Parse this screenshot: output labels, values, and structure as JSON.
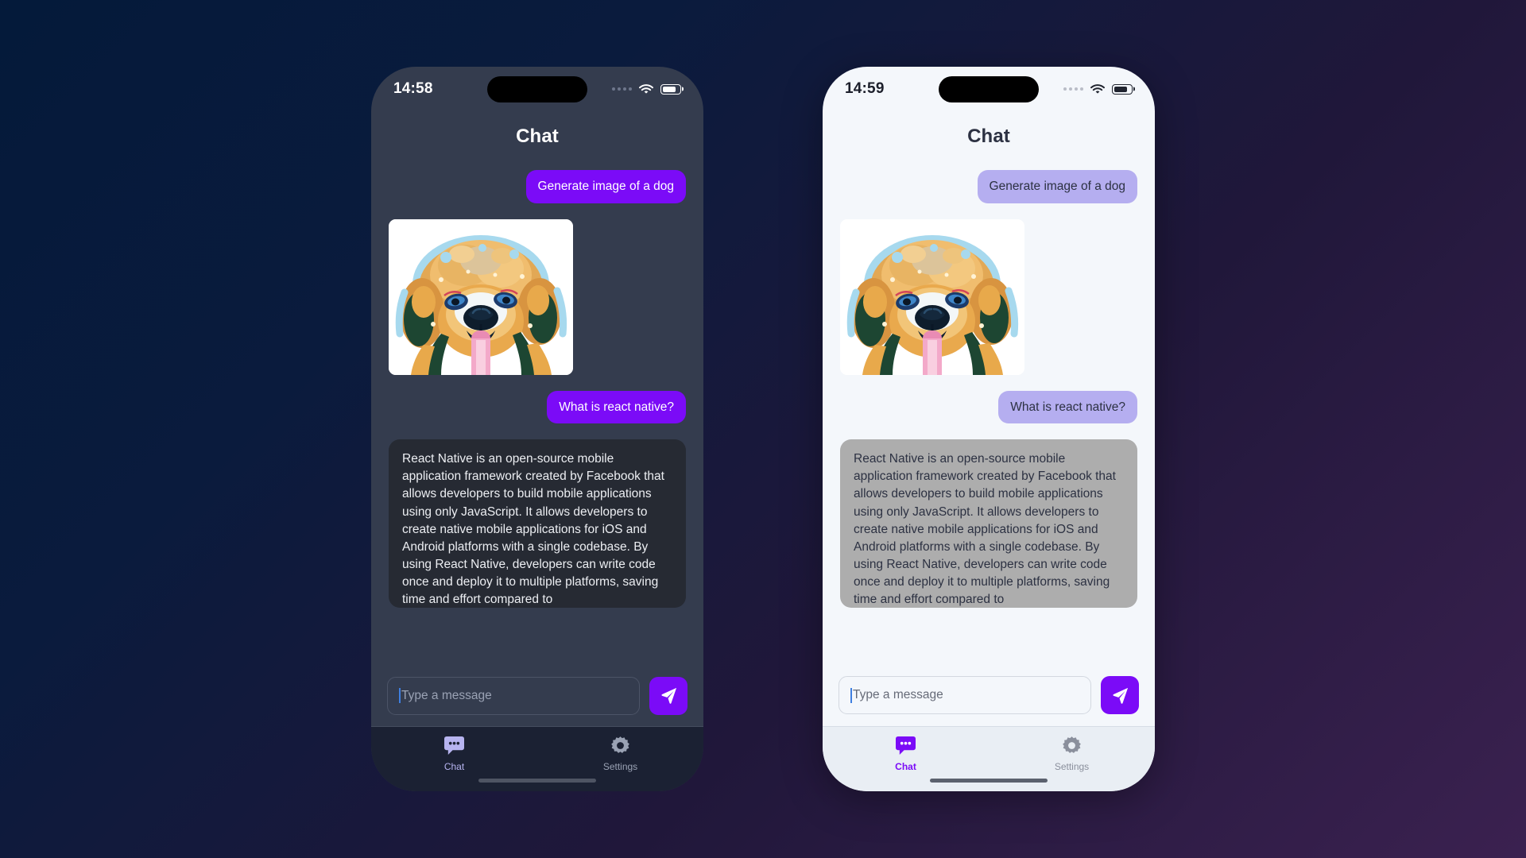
{
  "background": {
    "gradient_from": "#041a3a",
    "gradient_to": "#3b2150"
  },
  "accent": {
    "purple": "#7b0bf7",
    "lavender": "#b5aef0",
    "caret_blue": "#3f7fe0"
  },
  "phones": [
    {
      "theme": "dark",
      "status": {
        "time": "14:58",
        "signal_icon": "signal-dots-icon",
        "wifi_icon": "wifi-icon",
        "battery_icon": "battery-icon"
      },
      "header": {
        "title": "Chat"
      },
      "messages": [
        {
          "type": "text",
          "sender": "user",
          "text": "Generate image of a dog"
        },
        {
          "type": "image",
          "sender": "assistant",
          "alt": "generated-dog-image"
        },
        {
          "type": "text",
          "sender": "user",
          "text": "What is react native?"
        },
        {
          "type": "text",
          "sender": "assistant",
          "text": "React Native is an open-source mobile application framework created by Facebook that allows developers to build mobile applications using only JavaScript. It allows developers to create native mobile applications for iOS and Android platforms with a single codebase. By using React Native, developers can write code once and deploy it to multiple platforms, saving time and effort compared to"
        }
      ],
      "input": {
        "placeholder": "Type a message",
        "value": "",
        "send_icon": "send-paper-plane-icon"
      },
      "tabs": [
        {
          "label": "Chat",
          "icon": "chat-bubble-icon",
          "active": true
        },
        {
          "label": "Settings",
          "icon": "gear-icon",
          "active": false
        }
      ]
    },
    {
      "theme": "light",
      "status": {
        "time": "14:59",
        "signal_icon": "signal-dots-icon",
        "wifi_icon": "wifi-icon",
        "battery_icon": "battery-icon"
      },
      "header": {
        "title": "Chat"
      },
      "messages": [
        {
          "type": "text",
          "sender": "user",
          "text": "Generate image of a dog"
        },
        {
          "type": "image",
          "sender": "assistant",
          "alt": "generated-dog-image"
        },
        {
          "type": "text",
          "sender": "user",
          "text": "What is react native?"
        },
        {
          "type": "text",
          "sender": "assistant",
          "text": "React Native is an open-source mobile application framework created by Facebook that allows developers to build mobile applications using only JavaScript. It allows developers to create native mobile applications for iOS and Android platforms with a single codebase. By using React Native, developers can write code once and deploy it to multiple platforms, saving time and effort compared to"
        }
      ],
      "input": {
        "placeholder": "Type a message",
        "value": "",
        "send_icon": "send-paper-plane-icon"
      },
      "tabs": [
        {
          "label": "Chat",
          "icon": "chat-bubble-icon",
          "active": true
        },
        {
          "label": "Settings",
          "icon": "gear-icon",
          "active": false
        }
      ]
    }
  ]
}
